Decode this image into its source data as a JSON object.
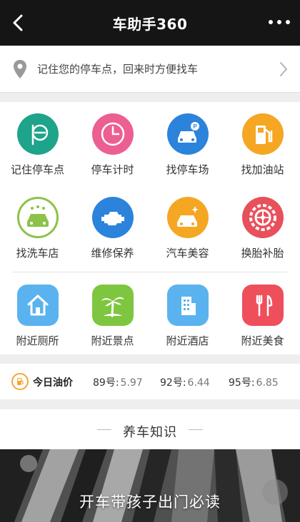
{
  "header": {
    "title": "车助手360"
  },
  "parking_banner": {
    "text": "记住您的停车点，回来时方便找车"
  },
  "grid": {
    "items": [
      {
        "label": "记住停车点",
        "icon": "parking-meter-icon",
        "color": "#1ea48a"
      },
      {
        "label": "停车计时",
        "icon": "clock-icon",
        "color": "#ec5f92"
      },
      {
        "label": "找停车场",
        "icon": "parking-lot-icon",
        "color": "#2c83dc"
      },
      {
        "label": "找加油站",
        "icon": "gas-station-icon",
        "color": "#f5a623"
      },
      {
        "label": "找洗车店",
        "icon": "car-wash-icon",
        "color": "#8bc34a"
      },
      {
        "label": "维修保养",
        "icon": "engine-icon",
        "color": "#2c83dc"
      },
      {
        "label": "汽车美容",
        "icon": "car-sparkle-icon",
        "color": "#f5a623"
      },
      {
        "label": "换胎补胎",
        "icon": "tire-icon",
        "color": "#e8505b"
      },
      {
        "label": "附近厕所",
        "icon": "home-icon",
        "color": "#5ab3ef"
      },
      {
        "label": "附近景点",
        "icon": "palm-tree-icon",
        "color": "#7ec63f"
      },
      {
        "label": "附近酒店",
        "icon": "building-icon",
        "color": "#5ab3ef"
      },
      {
        "label": "附近美食",
        "icon": "fork-knife-icon",
        "color": "#ee4f5b"
      }
    ]
  },
  "oil": {
    "label": "今日油价",
    "prices": [
      {
        "grade": "89号:",
        "value": "5.97"
      },
      {
        "grade": "92号:",
        "value": "6.44"
      },
      {
        "grade": "95号:",
        "value": "6.85"
      }
    ]
  },
  "knowledge": {
    "title": "养车知识"
  },
  "article": {
    "caption": "开车带孩子出门必读"
  }
}
